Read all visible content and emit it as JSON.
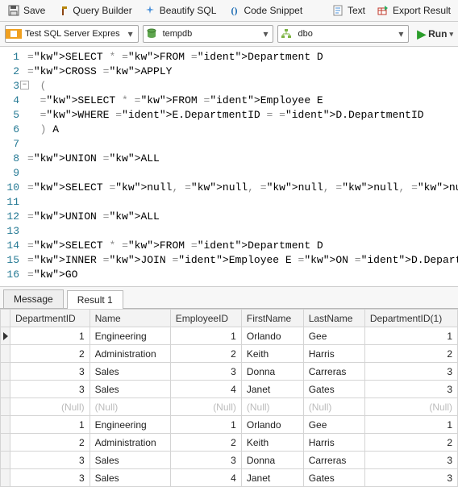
{
  "toolbar": {
    "save": "Save",
    "query_builder": "Query Builder",
    "beautify": "Beautify SQL",
    "snippet": "Code Snippet",
    "text": "Text",
    "export": "Export Result"
  },
  "dropdowns": {
    "connection": "Test SQL Server Expres",
    "database": "tempdb",
    "schema": "dbo"
  },
  "run_label": "Run",
  "editor": [
    {
      "n": "1",
      "t": "SELECT * FROM Department D",
      "c": [
        "kw",
        "kw",
        "kw",
        "ident",
        "ident"
      ]
    },
    {
      "n": "2",
      "t": "CROSS APPLY"
    },
    {
      "n": "3",
      "t": "  ("
    },
    {
      "n": "4",
      "t": "  SELECT * FROM Employee E"
    },
    {
      "n": "5",
      "t": "  WHERE E.DepartmentID = D.DepartmentID"
    },
    {
      "n": "6",
      "t": "  ) A"
    },
    {
      "n": "7",
      "t": ""
    },
    {
      "n": "8",
      "t": "UNION ALL"
    },
    {
      "n": "9",
      "t": ""
    },
    {
      "n": "10",
      "t": "SELECT null, null, null, null, null, null"
    },
    {
      "n": "11",
      "t": ""
    },
    {
      "n": "12",
      "t": "UNION ALL"
    },
    {
      "n": "13",
      "t": ""
    },
    {
      "n": "14",
      "t": "SELECT * FROM Department D"
    },
    {
      "n": "15",
      "t": "INNER JOIN Employee E ON D.DepartmentID = E.DepartmentID"
    },
    {
      "n": "16",
      "t": "GO"
    }
  ],
  "tabs": {
    "message": "Message",
    "result": "Result 1"
  },
  "columns": [
    "DepartmentID",
    "Name",
    "EmployeeID",
    "FirstName",
    "LastName",
    "DepartmentID(1)"
  ],
  "rows": [
    {
      "DepartmentID": "1",
      "Name": "Engineering",
      "EmployeeID": "1",
      "FirstName": "Orlando",
      "LastName": "Gee",
      "DepartmentID2": "1",
      "sel": true
    },
    {
      "DepartmentID": "2",
      "Name": "Administration",
      "EmployeeID": "2",
      "FirstName": "Keith",
      "LastName": "Harris",
      "DepartmentID2": "2"
    },
    {
      "DepartmentID": "3",
      "Name": "Sales",
      "EmployeeID": "3",
      "FirstName": "Donna",
      "LastName": "Carreras",
      "DepartmentID2": "3"
    },
    {
      "DepartmentID": "3",
      "Name": "Sales",
      "EmployeeID": "4",
      "FirstName": "Janet",
      "LastName": "Gates",
      "DepartmentID2": "3"
    },
    {
      "DepartmentID": "(Null)",
      "Name": "(Null)",
      "EmployeeID": "(Null)",
      "FirstName": "(Null)",
      "LastName": "(Null)",
      "DepartmentID2": "(Null)",
      "null": true
    },
    {
      "DepartmentID": "1",
      "Name": "Engineering",
      "EmployeeID": "1",
      "FirstName": "Orlando",
      "LastName": "Gee",
      "DepartmentID2": "1"
    },
    {
      "DepartmentID": "2",
      "Name": "Administration",
      "EmployeeID": "2",
      "FirstName": "Keith",
      "LastName": "Harris",
      "DepartmentID2": "2"
    },
    {
      "DepartmentID": "3",
      "Name": "Sales",
      "EmployeeID": "3",
      "FirstName": "Donna",
      "LastName": "Carreras",
      "DepartmentID2": "3"
    },
    {
      "DepartmentID": "3",
      "Name": "Sales",
      "EmployeeID": "4",
      "FirstName": "Janet",
      "LastName": "Gates",
      "DepartmentID2": "3"
    }
  ]
}
